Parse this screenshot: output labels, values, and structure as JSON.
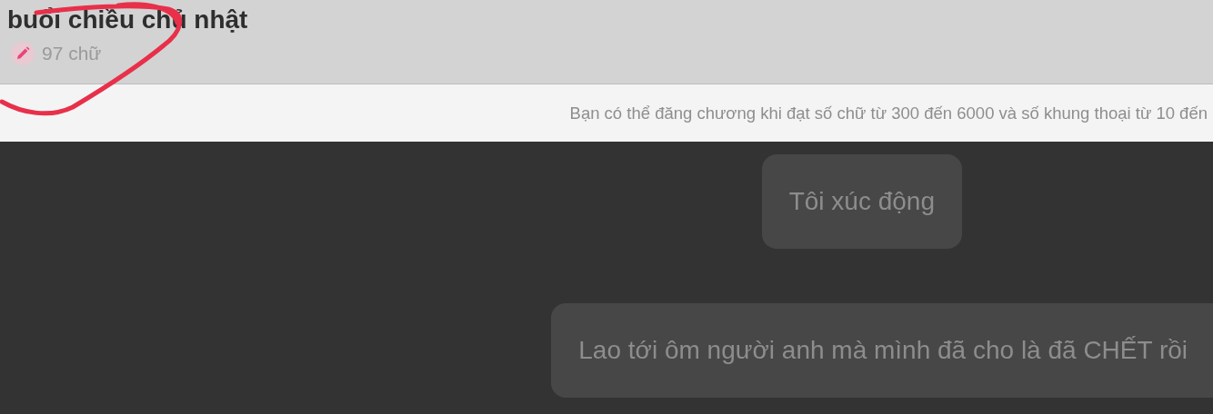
{
  "header": {
    "title": "buổi chiều chủ nhật",
    "word_count": "97 chữ"
  },
  "notice": "Bạn có thể đăng chương khi đạt số chữ từ 300 đến 6000 và số khung thoại từ 10 đến",
  "messages": [
    {
      "text": "Tôi xúc động"
    },
    {
      "text": "Lao tới ôm người anh mà mình đã cho là đã CHẾT rồi"
    }
  ]
}
